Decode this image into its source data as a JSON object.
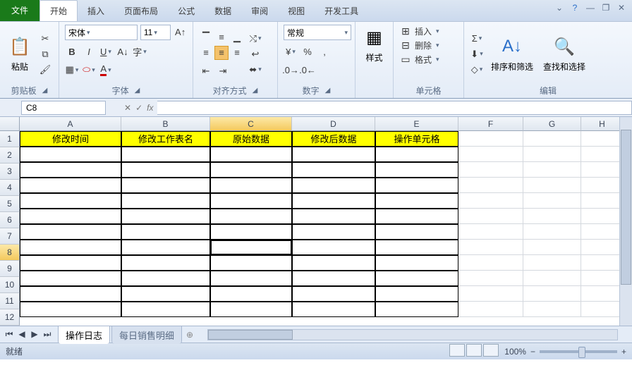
{
  "tabs": {
    "file": "文件",
    "home": "开始",
    "insert": "插入",
    "layout": "页面布局",
    "formulas": "公式",
    "data": "数据",
    "review": "审阅",
    "view": "视图",
    "dev": "开发工具"
  },
  "ribbon": {
    "clipboard": {
      "paste": "粘贴",
      "label": "剪贴板"
    },
    "font": {
      "name": "宋体",
      "size": "11",
      "label": "字体"
    },
    "align": {
      "label": "对齐方式"
    },
    "number": {
      "format": "常规",
      "label": "数字"
    },
    "styles": {
      "btn": "样式"
    },
    "cells": {
      "insert": "插入",
      "delete": "删除",
      "format": "格式",
      "label": "单元格"
    },
    "editing": {
      "sort": "排序和筛选",
      "find": "查找和选择",
      "label": "编辑"
    }
  },
  "namebox": "C8",
  "headers": {
    "A": "修改时间",
    "B": "修改工作表名",
    "C": "原始数据",
    "D": "修改后数据",
    "E": "操作单元格"
  },
  "cols": [
    "A",
    "B",
    "C",
    "D",
    "E",
    "F",
    "G",
    "H"
  ],
  "rows": [
    "1",
    "2",
    "3",
    "4",
    "5",
    "6",
    "7",
    "8",
    "9",
    "10",
    "11",
    "12"
  ],
  "sheets": {
    "s1": "操作日志",
    "s2": "每日销售明细"
  },
  "status": "就绪",
  "zoom": "100%"
}
